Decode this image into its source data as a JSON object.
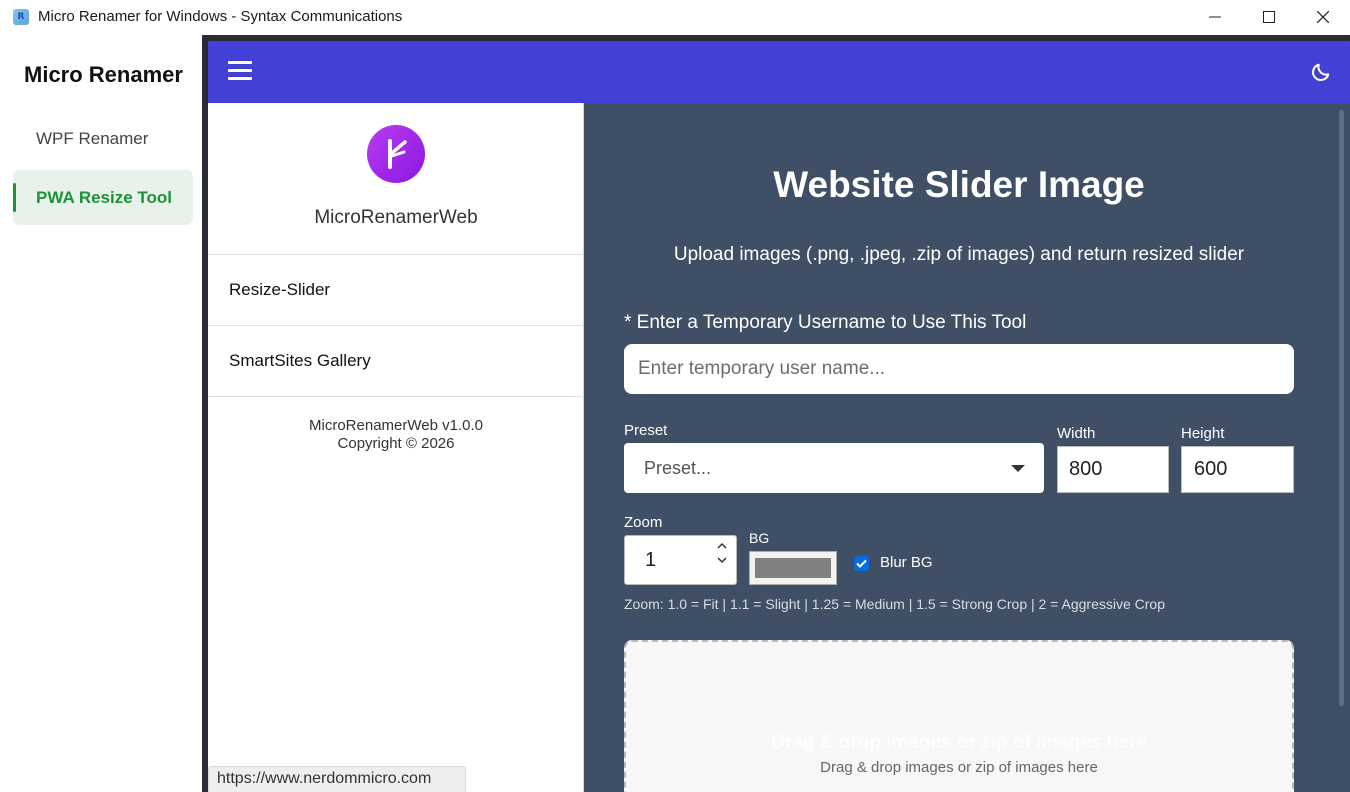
{
  "window": {
    "title": "Micro Renamer for Windows - Syntax Communications",
    "app_icon_letter": "R"
  },
  "wpf_nav": {
    "title": "Micro Renamer",
    "items": [
      {
        "label": "WPF Renamer",
        "active": false
      },
      {
        "label": "PWA Resize Tool",
        "active": true
      }
    ]
  },
  "drawer": {
    "brand": "MicroRenamerWeb",
    "items": [
      {
        "label": "Resize-Slider"
      },
      {
        "label": "SmartSites Gallery"
      }
    ],
    "version": "MicroRenamerWeb v1.0.0",
    "copyright": "Copyright © 2026"
  },
  "status_url": "https://www.nerdommicro.com",
  "main": {
    "title": "Website Slider Image",
    "subtitle": "Upload images (.png, .jpeg, .zip of images) and return resized slider",
    "username": {
      "label": "* Enter a Temporary Username to Use This Tool",
      "placeholder": "Enter temporary user name..."
    },
    "preset": {
      "label": "Preset",
      "value": "Preset..."
    },
    "width": {
      "label": "Width",
      "value": "800"
    },
    "height": {
      "label": "Height",
      "value": "600"
    },
    "zoom": {
      "label": "Zoom",
      "value": "1"
    },
    "bg": {
      "label": "BG",
      "color": "#808080"
    },
    "blur": {
      "label": "Blur BG",
      "checked": true
    },
    "zoom_help": "Zoom: 1.0 = Fit | 1.1 = Slight | 1.25 = Medium | 1.5 = Strong Crop | 2 = Aggressive Crop",
    "dropzone": {
      "heading": "Drag & drop images or zip of images here",
      "text": "Drag & drop images or zip of images here"
    }
  },
  "colors": {
    "appbar": "#4340d6",
    "main_bg": "#3e4f66",
    "active_nav": "#1e9139",
    "active_nav_bg": "#e7f3ea"
  },
  "icons": [
    "app-icon",
    "minimize-icon",
    "maximize-icon",
    "close-icon",
    "hamburger-icon",
    "moon-icon",
    "logo-icon",
    "chevron-down-icon",
    "spin-up-icon",
    "spin-down-icon",
    "checkmark-icon"
  ]
}
